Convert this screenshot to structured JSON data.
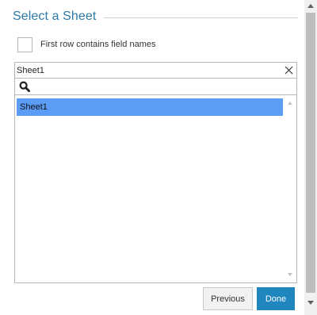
{
  "header": {
    "title": "Select a Sheet"
  },
  "options": {
    "first_row_label": "First row contains field names",
    "first_row_checked": false
  },
  "sheet_select": {
    "value": "Sheet1"
  },
  "search": {
    "placeholder": "",
    "value": ""
  },
  "sheet_list": {
    "items": [
      "Sheet1"
    ],
    "selected": "Sheet1"
  },
  "buttons": {
    "previous": "Previous",
    "done": "Done"
  },
  "colors": {
    "accent": "#2b79a8",
    "selection": "#5a9cf6",
    "primary_button": "#1f86be"
  },
  "icons": {
    "clear": "close-icon",
    "search": "search-icon"
  }
}
